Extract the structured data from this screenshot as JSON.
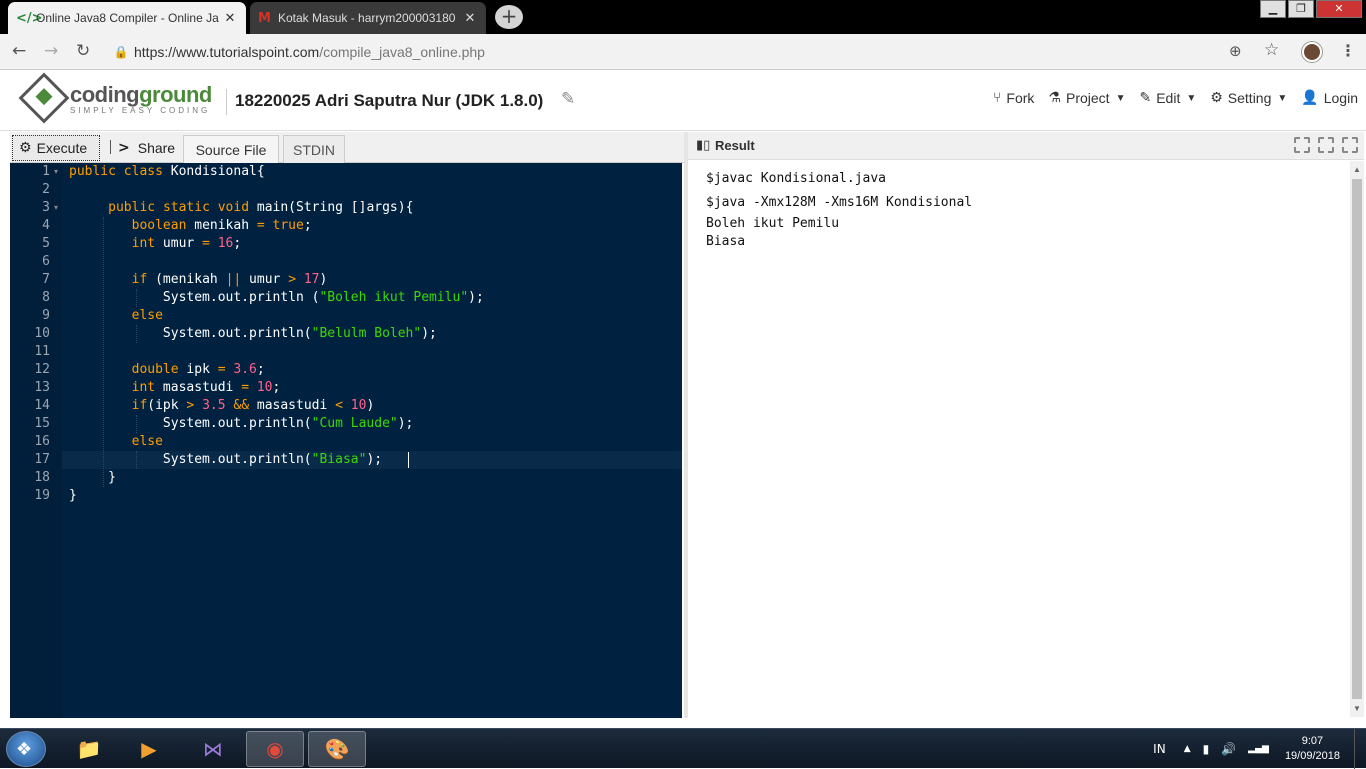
{
  "browser": {
    "tabs": [
      {
        "icon": "</>",
        "title": "Online Java8 Compiler - Online Ja",
        "close": "✕"
      },
      {
        "icon": "M",
        "title": "Kotak Masuk - harrym200003180",
        "close": "✕"
      }
    ],
    "new_tab": "+",
    "window_controls": {
      "minimize": "▁",
      "maximize": "❐",
      "close": "✕"
    },
    "nav": {
      "back": "←",
      "forward": "→",
      "reload": "↻"
    },
    "url_base": "https://www.tutorialspoint.com",
    "url_rest": "/compile_java8_online.php",
    "zoom_icon": "⊕",
    "star_icon": "☆",
    "menu_icon": "⋮"
  },
  "site": {
    "logo_main_1": "coding",
    "logo_main_2": "ground",
    "logo_tagline": "SIMPLY EASY CODING",
    "project_title": "18220025 Adri Saputra Nur (JDK 1.8.0)",
    "edit_icon": "✎",
    "menu": [
      {
        "icon": "⑂",
        "label": "Fork",
        "caret": ""
      },
      {
        "icon": "⚗",
        "label": "Project",
        "caret": "▼"
      },
      {
        "icon": "✎",
        "label": "Edit",
        "caret": "▼"
      },
      {
        "icon": "⚙",
        "label": "Setting",
        "caret": "▼"
      },
      {
        "icon": "👤",
        "label": "Login",
        "caret": ""
      }
    ]
  },
  "toolbar": {
    "execute_icon": "⚙",
    "execute_label": "Execute",
    "separator": "|",
    "share_icon": ">",
    "share_label": "Share",
    "tabs": [
      "Source File",
      "STDIN"
    ]
  },
  "editor": {
    "line_numbers": [
      "1",
      "2",
      "3",
      "4",
      "5",
      "6",
      "7",
      "8",
      "9",
      "10",
      "11",
      "12",
      "13",
      "14",
      "15",
      "16",
      "17",
      "18",
      "19"
    ],
    "fold_marker": "▾",
    "active_line": 17
  },
  "result": {
    "title": "Result",
    "lines": [
      "$javac Kondisional.java",
      "$java -Xmx128M -Xms16M Kondisional",
      "Boleh ikut Pemilu",
      "Biasa"
    ]
  },
  "taskbar": {
    "apps": [
      {
        "icon": "📁",
        "name": "explorer"
      },
      {
        "icon": "▶",
        "name": "media-player"
      },
      {
        "icon": "⋈",
        "name": "visual-studio"
      },
      {
        "icon": "◉",
        "name": "chrome"
      },
      {
        "icon": "🎨",
        "name": "paint"
      }
    ],
    "lang": "IN",
    "tray_icons": [
      "▲",
      "▮",
      "🔊",
      "▂▄▆"
    ],
    "time": "9:07",
    "date": "19/09/2018"
  },
  "colors": {
    "editor_bg": "#002240",
    "keyword": "#ff9d00",
    "string": "#3ad900",
    "number": "#ff628c",
    "logo_accent": "#4a8a3a"
  }
}
